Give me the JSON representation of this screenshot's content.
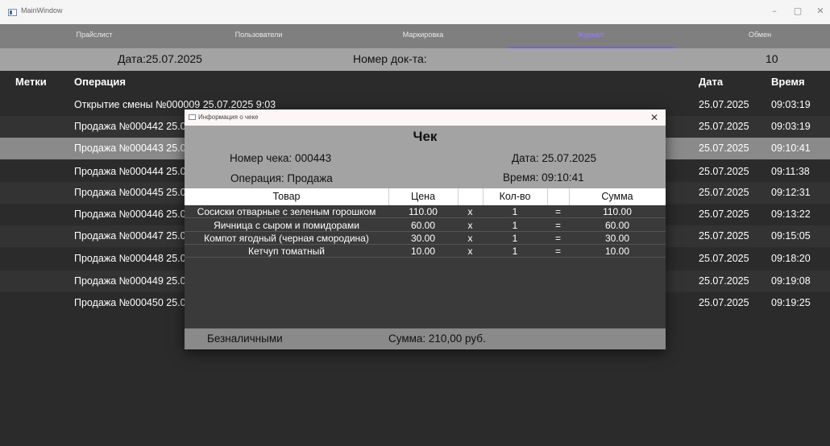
{
  "window": {
    "title": "MainWindow",
    "controls": [
      "–",
      "▢",
      "✕"
    ]
  },
  "nav": {
    "tabs": [
      "Прайслист",
      "Пользователи",
      "Маркировка",
      "Журнал",
      "Обмен"
    ],
    "active": "Журнал"
  },
  "info": {
    "date": "Дата:25.07.2025",
    "doc_label": "Номер док-та:",
    "doc_value": "10"
  },
  "table": {
    "headers": {
      "tags": "Метки",
      "operation": "Операция",
      "date": "Дата",
      "time": "Время"
    },
    "rows": [
      {
        "op": "Открытие смены №000009 25.07.2025 9:03",
        "date": "25.07.2025",
        "time": "09:03:19"
      },
      {
        "op": "Продажа №000442 25.0",
        "date": "25.07.2025",
        "time": "09:03:19"
      },
      {
        "op": "Продажа №000443 25.0",
        "date": "25.07.2025",
        "time": "09:10:41"
      },
      {
        "op": "Продажа №000444 25.0",
        "date": "25.07.2025",
        "time": "09:11:38"
      },
      {
        "op": "Продажа №000445 25.0",
        "date": "25.07.2025",
        "time": "09:12:31"
      },
      {
        "op": "Продажа №000446 25.0",
        "date": "25.07.2025",
        "time": "09:13:22"
      },
      {
        "op": "Продажа №000447 25.0",
        "date": "25.07.2025",
        "time": "09:15:05"
      },
      {
        "op": "Продажа №000448 25.0",
        "date": "25.07.2025",
        "time": "09:18:20"
      },
      {
        "op": "Продажа №000449 25.0",
        "date": "25.07.2025",
        "time": "09:19:08"
      },
      {
        "op": "Продажа №000450 25.0",
        "date": "25.07.2025",
        "time": "09:19:25"
      }
    ]
  },
  "dialog": {
    "title": "Информация о чеке",
    "close": "✕",
    "heading": "Чек",
    "receipt_no": "Номер чека: 000443",
    "date": "Дата: 25.07.2025",
    "operation": "Операция: Продажа",
    "time": "Время: 09:10:41",
    "columns": {
      "item": "Товар",
      "price": "Цена",
      "qty": "Кол-во",
      "sum": "Сумма"
    },
    "items": [
      {
        "name": "Сосиски отварные с зеленым горошком",
        "price": "110.00",
        "x": "x",
        "qty": "1",
        "eq": "=",
        "sum": "110.00"
      },
      {
        "name": "Яичница с сыром и помидорами",
        "price": "60.00",
        "x": "x",
        "qty": "1",
        "eq": "=",
        "sum": "60.00"
      },
      {
        "name": "Компот ягодный (черная смородина)",
        "price": "30.00",
        "x": "x",
        "qty": "1",
        "eq": "=",
        "sum": "30.00"
      },
      {
        "name": "Кетчуп томатный",
        "price": "10.00",
        "x": "x",
        "qty": "1",
        "eq": "=",
        "sum": "10.00"
      }
    ],
    "payment": "Безналичными",
    "total": "Сумма: 210,00 руб."
  }
}
